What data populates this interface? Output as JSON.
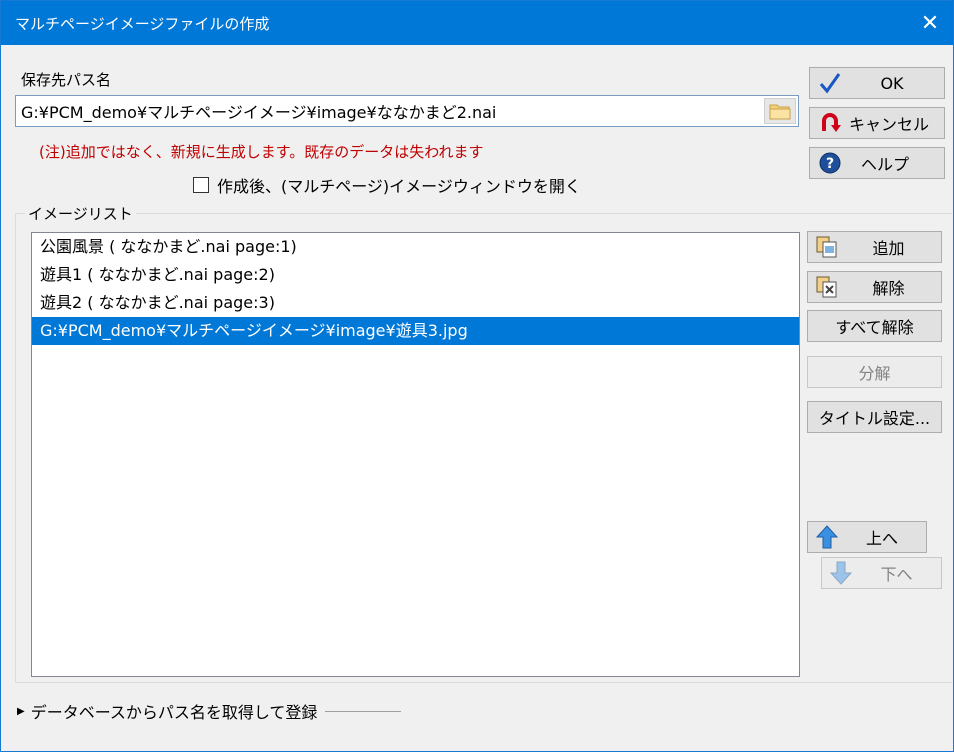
{
  "window": {
    "title": "マルチページイメージファイルの作成",
    "close_glyph": "✕"
  },
  "save_path": {
    "label": "保存先パス名",
    "value": "G:¥PCM_demo¥マルチページイメージ¥image¥ななかまど2.nai",
    "note": "(注)追加ではなく、新規に生成します。既存のデータは失われます"
  },
  "open_after": {
    "label": "作成後、(マルチページ)イメージウィンドウを開く",
    "checked": false
  },
  "buttons": {
    "ok": "OK",
    "cancel": "キャンセル",
    "help": "ヘルプ"
  },
  "image_list": {
    "label": "イメージリスト",
    "items": [
      "公園風景 ( ななかまど.nai page:1)",
      "遊具1 ( ななかまど.nai page:2)",
      "遊具2 ( ななかまど.nai page:3)",
      "G:¥PCM_demo¥マルチページイメージ¥image¥遊具3.jpg"
    ],
    "selected_index": 3
  },
  "list_buttons": {
    "add": "追加",
    "remove": "解除",
    "remove_all": "すべて解除",
    "split": "分解",
    "title_settings": "タイトル設定...",
    "up": "上へ",
    "down": "下へ"
  },
  "db_register": {
    "label": "データベースからパス名を取得して登録"
  },
  "colors": {
    "titlebar": "#0078d7",
    "selection": "#0078d7",
    "note": "#c00000"
  },
  "icons": {
    "ok": "check-icon",
    "cancel": "undo-arrow-icon",
    "help": "question-icon",
    "folder": "folder-icon",
    "add": "add-image-icon",
    "remove": "remove-image-icon",
    "up": "arrow-up-icon",
    "down": "arrow-down-icon"
  }
}
